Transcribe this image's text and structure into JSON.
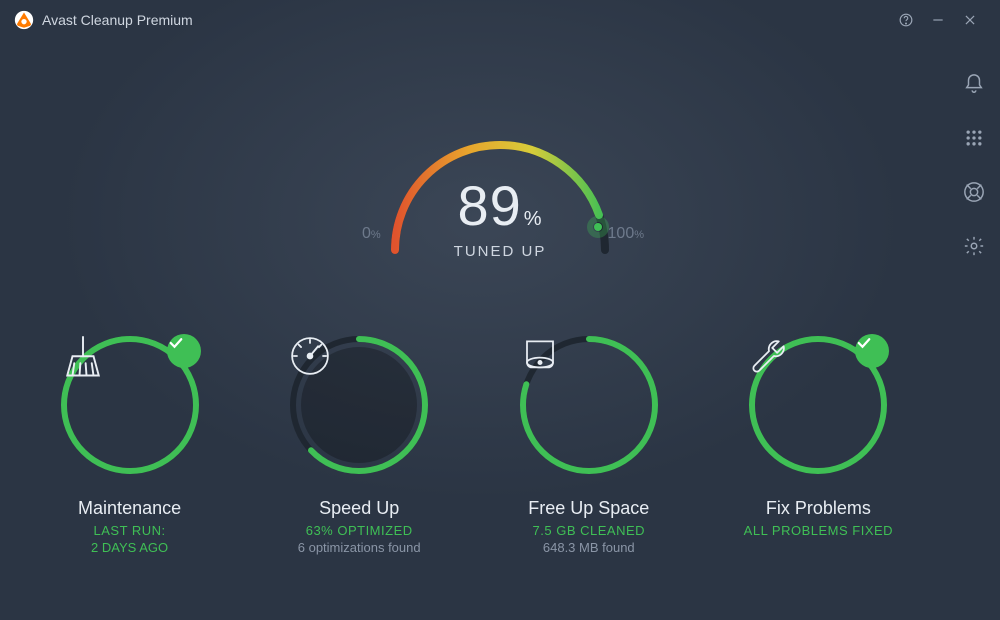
{
  "app_title": "Avast Cleanup Premium",
  "gauge": {
    "value": "89",
    "pct": "%",
    "label": "TUNED UP",
    "min": "0",
    "max": "100"
  },
  "tiles": [
    {
      "title": "Maintenance",
      "line1": "LAST RUN:",
      "line2": "2 DAYS AGO",
      "line2_green": true,
      "progress": 100,
      "badge": true,
      "icon": "broom"
    },
    {
      "title": "Speed Up",
      "line1": "63% OPTIMIZED",
      "line2": "6 optimizations found",
      "line2_green": false,
      "progress": 63,
      "badge": false,
      "icon": "speedometer"
    },
    {
      "title": "Free Up Space",
      "line1": "7.5 GB CLEANED",
      "line2": "648.3 MB found",
      "line2_green": false,
      "progress": 80,
      "badge": false,
      "icon": "disk"
    },
    {
      "title": "Fix Problems",
      "line1": "ALL PROBLEMS FIXED",
      "line2": "",
      "line2_green": false,
      "progress": 100,
      "badge": true,
      "icon": "wrench"
    }
  ]
}
